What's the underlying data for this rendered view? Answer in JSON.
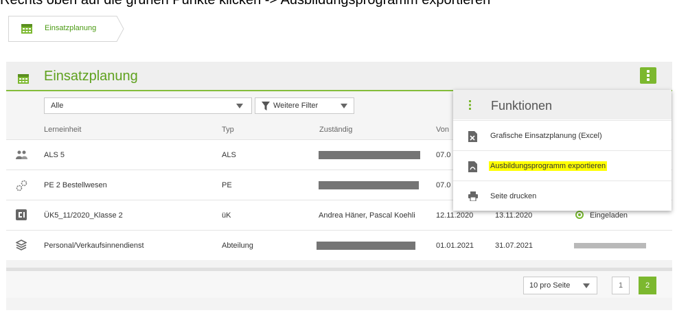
{
  "instruction": "Rechts oben auf die grünen Punkte klicken -> Ausbildungsprogramm exportieren",
  "breadcrumb": {
    "label": "Einsatzplanung"
  },
  "panel": {
    "title": "Einsatzplanung"
  },
  "filters": {
    "select_value": "Alle",
    "more_filters_label": "Weitere Filter"
  },
  "table": {
    "headers": {
      "lerneinheit": "Lerneinheit",
      "typ": "Typ",
      "zustaendig": "Zuständig",
      "von": "Von"
    },
    "rows": [
      {
        "icon": "group-icon",
        "lerneinheit": "ALS 5",
        "typ": "ALS",
        "zustaendig": "",
        "von": "07.0",
        "bis": "",
        "status": ""
      },
      {
        "icon": "gears-icon",
        "lerneinheit": "PE 2 Bestellwesen",
        "typ": "PE",
        "zustaendig": "",
        "von": "07.0",
        "bis": "",
        "status": ""
      },
      {
        "icon": "course-icon",
        "lerneinheit": "ÜK5_11/2020_Klasse 2",
        "typ": "üK",
        "zustaendig": "Andrea Häner, Pascal Koehli",
        "von": "12.11.2020",
        "bis": "13.11.2020",
        "status": "Eingeladen"
      },
      {
        "icon": "layers-icon",
        "lerneinheit": "Personal/Verkaufsinnendienst",
        "typ": "Abteilung",
        "zustaendig": "",
        "von": "01.01.2021",
        "bis": "31.07.2021",
        "status": ""
      }
    ]
  },
  "pagination": {
    "per_page": "10 pro Seite",
    "pages": [
      "1",
      "2"
    ],
    "current": "2"
  },
  "functions_menu": {
    "title": "Funktionen",
    "items": [
      {
        "label": "Grafische Einsatzplanung (Excel)",
        "icon": "excel-file-icon"
      },
      {
        "label": "Ausbildungsprogramm exportieren",
        "icon": "pdf-file-icon"
      },
      {
        "label": "Seite drucken",
        "icon": "print-icon"
      }
    ]
  },
  "colors": {
    "accent": "#7cb82f",
    "title_green": "#5fa11e",
    "highlight": "#ffff00"
  }
}
